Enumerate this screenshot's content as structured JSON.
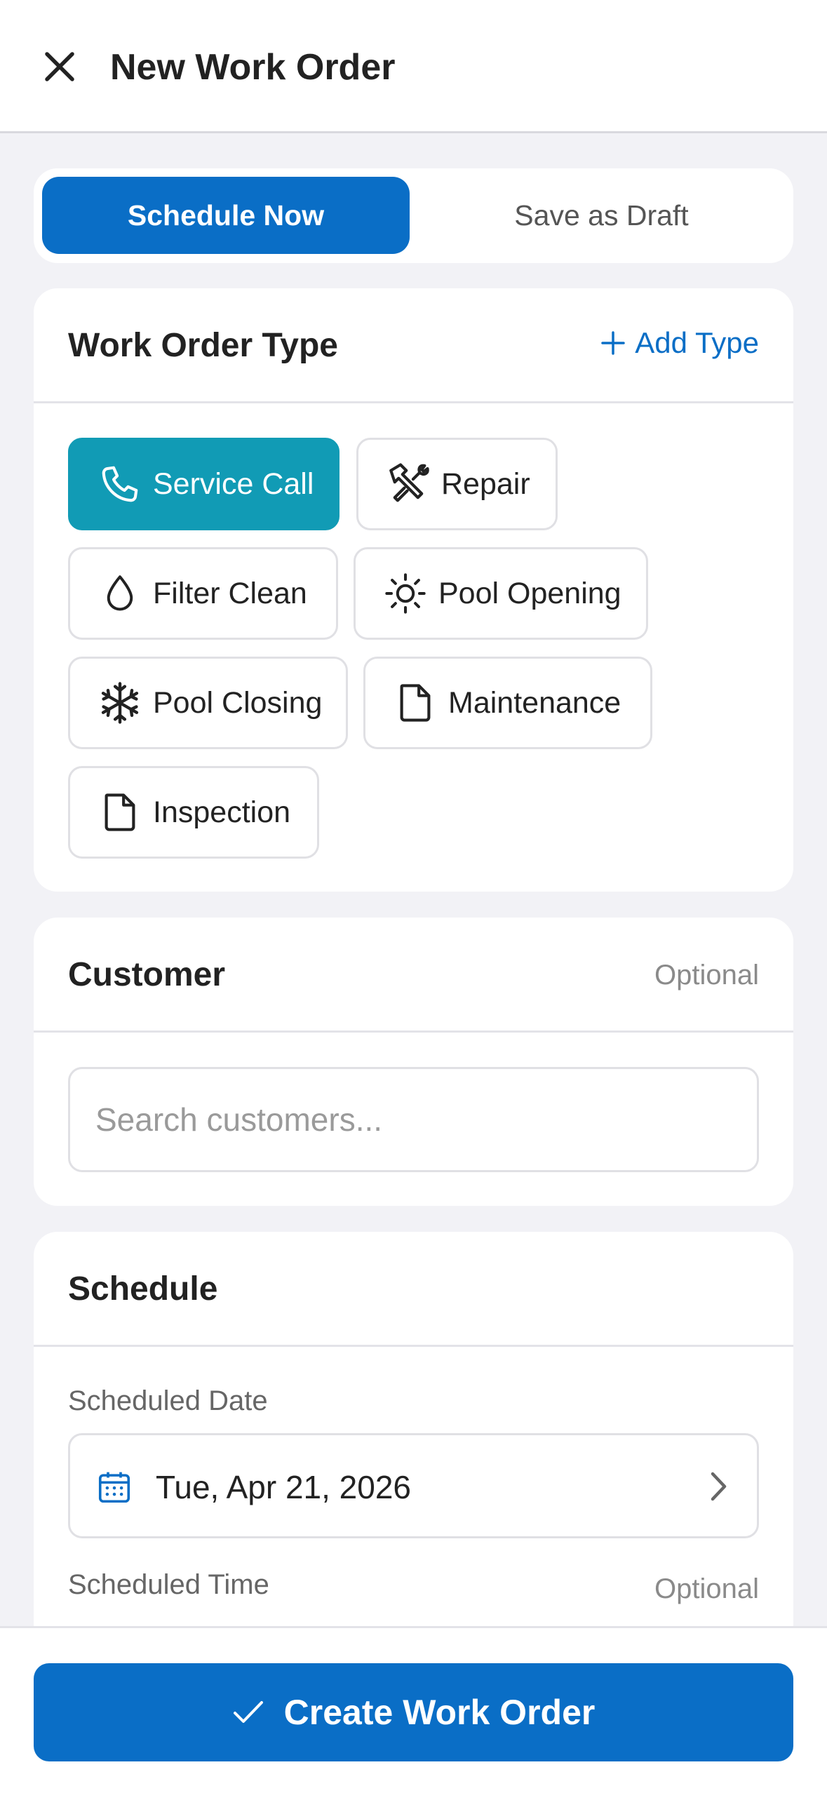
{
  "header": {
    "title": "New Work Order",
    "close_icon": "close-icon"
  },
  "segment": {
    "active_label": "Schedule Now",
    "inactive_label": "Save as Draft"
  },
  "work_order_type": {
    "title": "Work Order Type",
    "add_label": "Add Type",
    "chips": [
      {
        "label": "Service Call",
        "icon": "phone-icon",
        "selected": true
      },
      {
        "label": "Repair",
        "icon": "tools-icon",
        "selected": false
      },
      {
        "label": "Filter Clean",
        "icon": "droplet-icon",
        "selected": false
      },
      {
        "label": "Pool Opening",
        "icon": "sun-icon",
        "selected": false
      },
      {
        "label": "Pool Closing",
        "icon": "snowflake-icon",
        "selected": false
      },
      {
        "label": "Maintenance",
        "icon": "document-icon",
        "selected": false
      },
      {
        "label": "Inspection",
        "icon": "document-icon",
        "selected": false
      }
    ]
  },
  "customer": {
    "title": "Customer",
    "optional": "Optional",
    "search_placeholder": "Search customers..."
  },
  "schedule": {
    "title": "Schedule",
    "date_label": "Scheduled Date",
    "date_value": "Tue, Apr 21, 2026",
    "time_label": "Scheduled Time",
    "time_optional": "Optional"
  },
  "footer": {
    "cta_label": "Create Work Order"
  },
  "colors": {
    "primary": "#0a6ec6",
    "selected_chip": "#119bb5",
    "background": "#f2f2f6"
  }
}
